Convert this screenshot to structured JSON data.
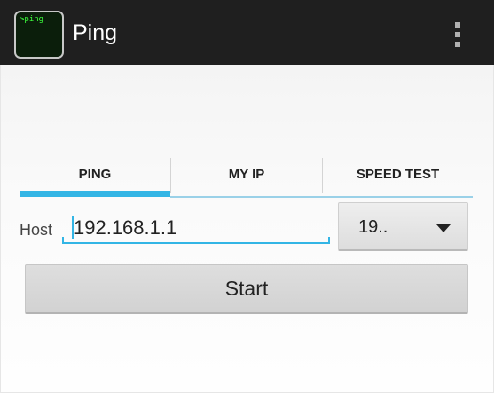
{
  "action_bar": {
    "icon_text": ">ping",
    "title": "Ping",
    "overflow_icon": "more-vert-icon"
  },
  "tabs": [
    {
      "label": "PING",
      "selected": true
    },
    {
      "label": "MY IP",
      "selected": false
    },
    {
      "label": "SPEED TEST",
      "selected": false
    }
  ],
  "form": {
    "host_label": "Host",
    "host_value": "192.168.1.1",
    "spinner_value": "19..",
    "spinner_icon": "dropdown-arrow-icon",
    "start_label": "Start"
  },
  "colors": {
    "action_bar": "#1f1f1f",
    "accent": "#33b5e5",
    "icon_text": "#3cff3c"
  }
}
